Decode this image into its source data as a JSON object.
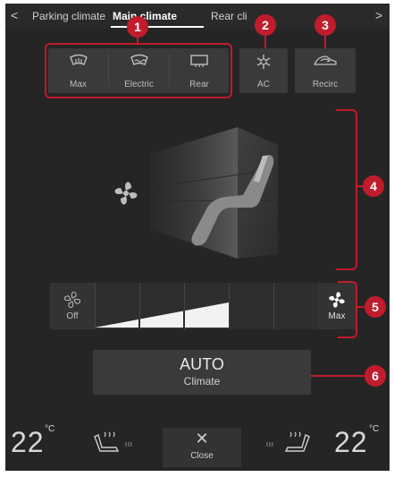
{
  "tabs": {
    "back_chevron": "<",
    "items": [
      "Parking climate",
      "Main climate",
      "Rear climate"
    ],
    "item0": "Parking climate",
    "item1_prefix": "Main",
    "item1_rest": " climate",
    "item2": "Rear cli",
    "next_chevron": ">"
  },
  "top_buttons": {
    "max_defrost": "Max",
    "electric_defrost": "Electric",
    "rear_defrost": "Rear",
    "ac": "AC",
    "recirc": "Recirc"
  },
  "fan": {
    "off_label": "Off",
    "max_label": "Max",
    "level_steps": 6,
    "level_active": 3
  },
  "auto": {
    "title": "AUTO",
    "subtitle": "Climate"
  },
  "bottom": {
    "left_temp": "22",
    "right_temp": "22",
    "unit": "°C",
    "close_label": "Close",
    "close_glyph": "✕",
    "seat_level_left": "III",
    "seat_level_right": "III"
  },
  "callouts": [
    "1",
    "2",
    "3",
    "4",
    "5",
    "6"
  ],
  "colors": {
    "background": "#252525",
    "callout": "#c01c2c",
    "button": "#3a3a3a"
  }
}
